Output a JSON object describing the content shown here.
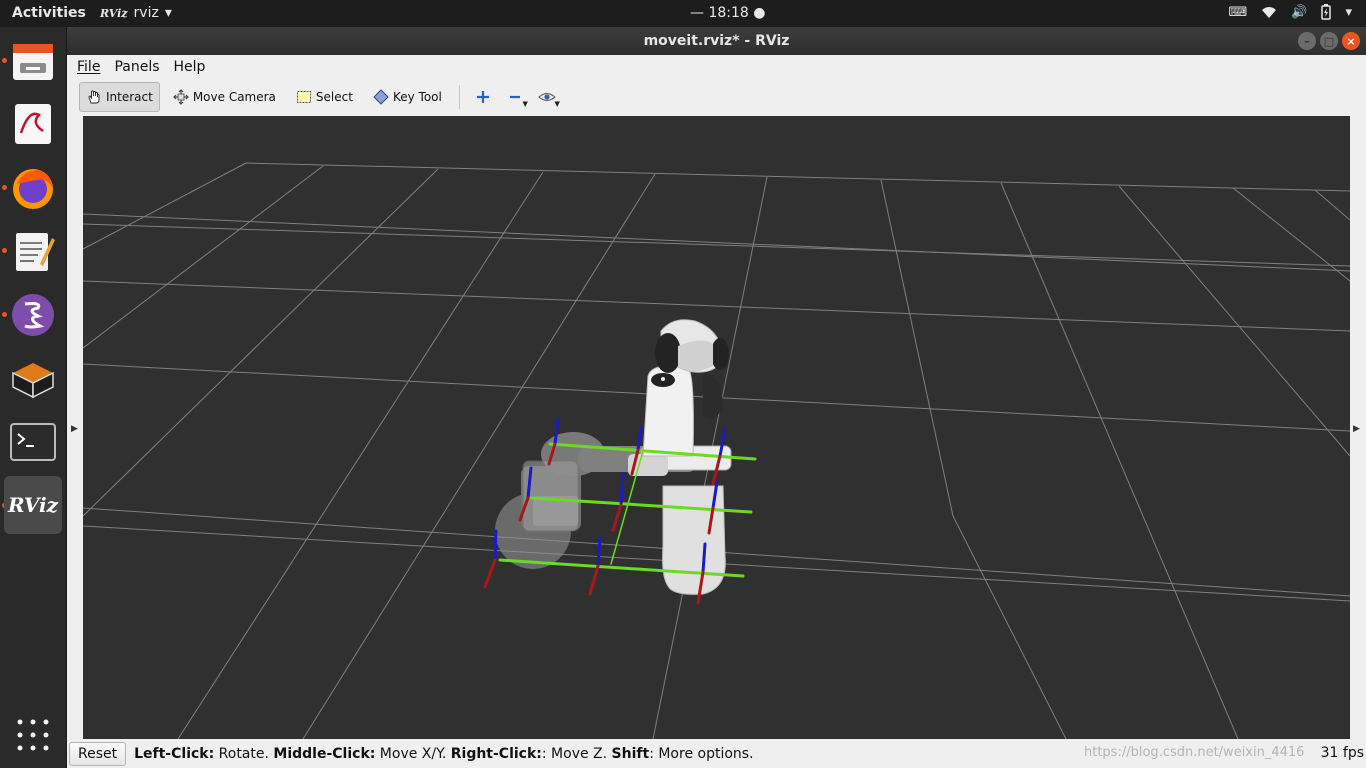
{
  "topbar": {
    "activities": "Activities",
    "app_name": "rviz",
    "app_logo_text": "RViz",
    "clock": "— 18:18 ●"
  },
  "window": {
    "title": "moveit.rviz* - RViz"
  },
  "menu": {
    "file": "File",
    "panels": "Panels",
    "help": "Help"
  },
  "toolbar": {
    "interact": "Interact",
    "move_camera": "Move Camera",
    "select": "Select",
    "key_tool": "Key Tool"
  },
  "dock": {
    "items": [
      "files-icon",
      "document-viewer-icon",
      "firefox-icon",
      "text-editor-icon",
      "emacs-icon",
      "virtualbox-icon",
      "terminal-icon",
      "rviz-icon"
    ],
    "rviz_label": "RViz"
  },
  "status": {
    "reset": "Reset",
    "left_click_key": "Left-Click:",
    "left_click_val": " Rotate. ",
    "middle_click_key": "Middle-Click:",
    "middle_click_val": " Move X/Y. ",
    "right_click_key": "Right-Click:",
    "right_click_val": ": Move Z. ",
    "shift_key": "Shift",
    "shift_val": ": More options.",
    "fps": "31 fps",
    "watermark": "https://blog.csdn.net/weixin_4416"
  },
  "colors": {
    "accent": "#e95420",
    "grid_bg": "#303030",
    "grid_line": "#a0a0a0",
    "axis_x": "#b81a1a",
    "axis_y": "#66dd22",
    "axis_z": "#1a1ac8"
  }
}
